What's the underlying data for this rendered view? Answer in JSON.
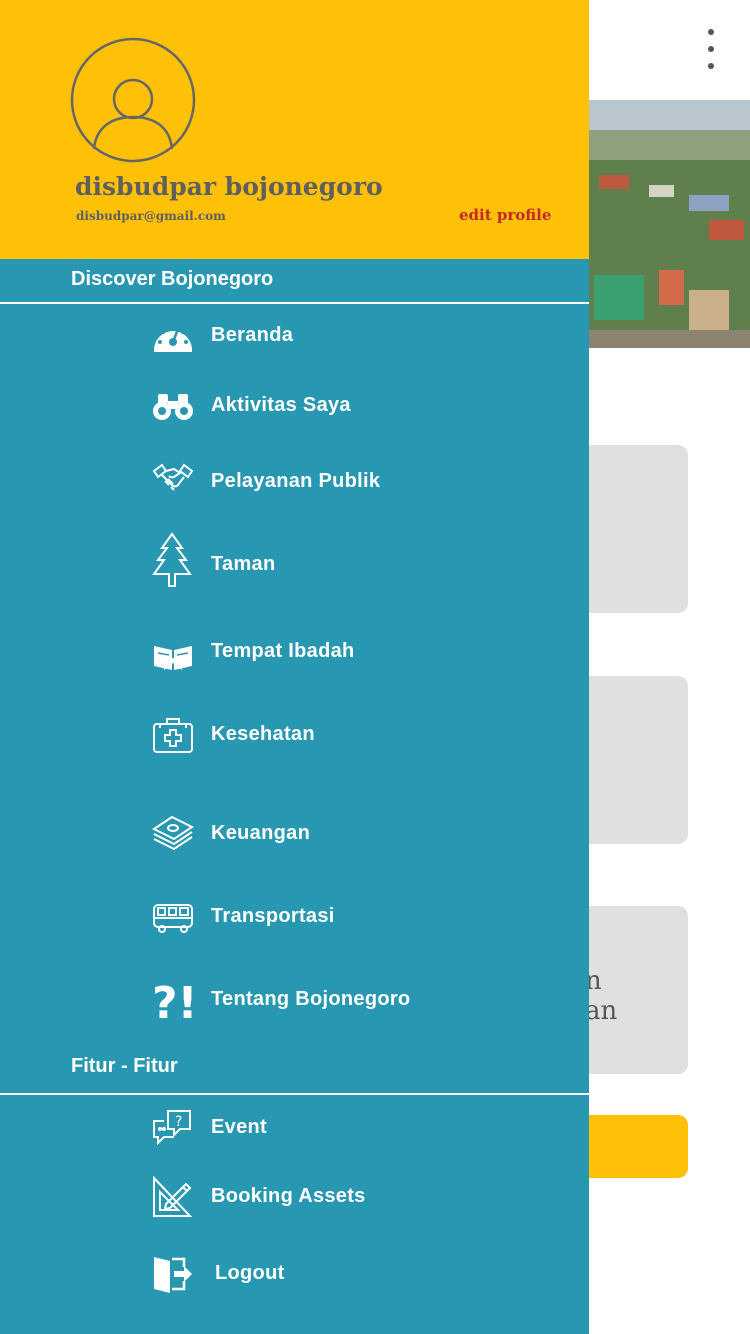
{
  "header": {
    "user_name": "disbudpar bojonegoro",
    "user_email": "disbudpar@gmail.com",
    "edit_profile_label": "edit profile"
  },
  "sections": {
    "discover_title": "Discover Bojonegoro",
    "fitur_title": "Fitur - Fitur"
  },
  "menu": {
    "beranda": "Beranda",
    "aktivitas": "Aktivitas Saya",
    "pelayanan": "Pelayanan Publik",
    "taman": "Taman",
    "ibadah": "Tempat Ibadah",
    "kesehatan": "Kesehatan",
    "keuangan": "Keuangan",
    "transportasi": "Transportasi",
    "tentang": "Tentang Bojonegoro",
    "event": "Event",
    "booking": "Booking  Assets",
    "logout": "Logout"
  },
  "background": {
    "card3_text_line1": "n",
    "card3_text_line2": "an"
  },
  "icons": {
    "avatar": "user-circle-icon",
    "beranda": "speedometer-icon",
    "aktivitas": "binoculars-icon",
    "pelayanan": "handshake-icon",
    "taman": "pine-tree-icon",
    "ibadah": "open-book-icon",
    "kesehatan": "first-aid-kit-icon",
    "keuangan": "money-stack-icon",
    "transportasi": "bus-icon",
    "tentang": "question-exclamation-icon",
    "event": "chat-question-icon",
    "booking": "drafting-pencil-icon",
    "logout": "logout-door-icon"
  },
  "colors": {
    "drawer_bg": "#2897B2",
    "header_bg": "#FFC107",
    "edit_profile": "#C62828"
  }
}
